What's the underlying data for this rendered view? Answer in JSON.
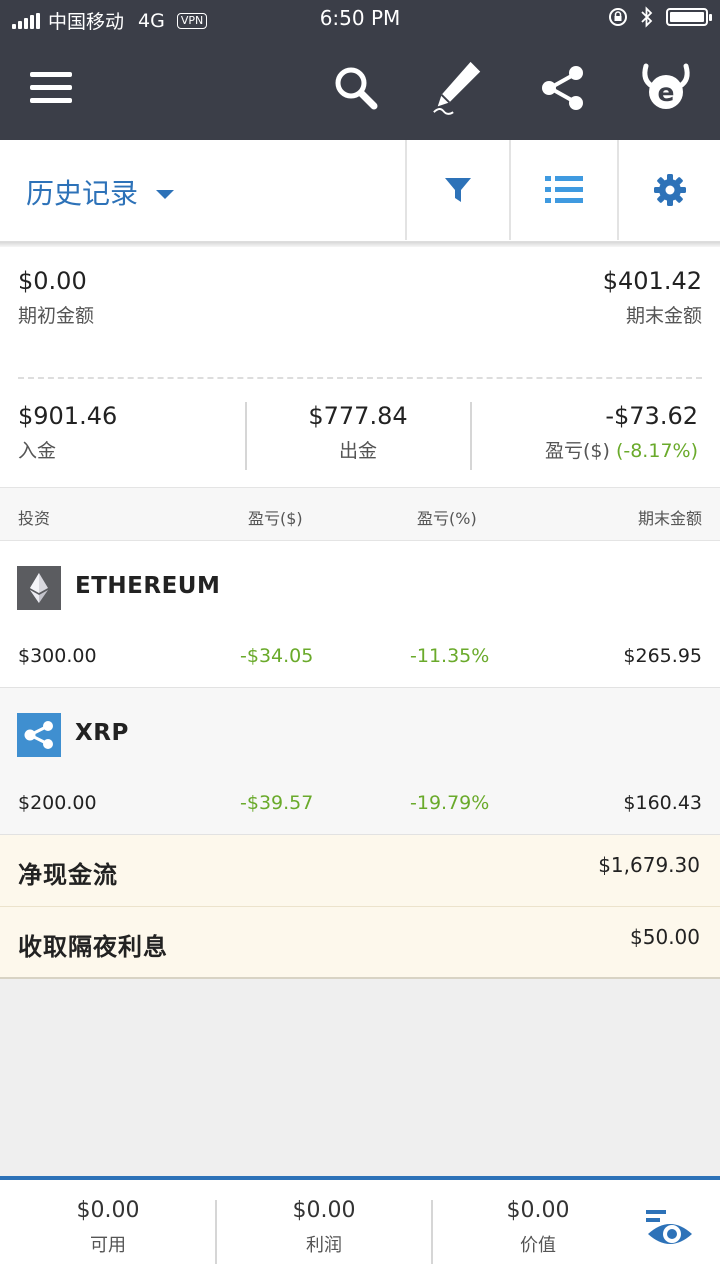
{
  "status_bar": {
    "carrier": "中国移动",
    "network": "4G",
    "vpn": "VPN",
    "time": "6:50 PM"
  },
  "header": {
    "title": "历史记录"
  },
  "summary": {
    "opening": {
      "value": "$0.00",
      "label": "期初金额"
    },
    "closing": {
      "value": "$401.42",
      "label": "期末金额"
    },
    "deposits": {
      "value": "$901.46",
      "label": "入金"
    },
    "withdrawals": {
      "value": "$777.84",
      "label": "出金"
    },
    "profit": {
      "value": "-$73.62",
      "label": "盈亏($)",
      "percent": "(-8.17%)"
    }
  },
  "table": {
    "headers": {
      "invest": "投资",
      "pl_usd": "盈亏($)",
      "pl_pct": "盈亏(%)",
      "end_amount": "期末金额"
    },
    "rows": [
      {
        "name": "ETHEREUM",
        "icon": "ethereum-icon",
        "invested": "$300.00",
        "pl_usd": "-$34.05",
        "pl_pct": "-11.35%",
        "end": "$265.95"
      },
      {
        "name": "XRP",
        "icon": "xrp-icon",
        "invested": "$200.00",
        "pl_usd": "-$39.57",
        "pl_pct": "-19.79%",
        "end": "$160.43"
      }
    ]
  },
  "cash_items": [
    {
      "label": "净现金流",
      "value": "$1,679.30"
    },
    {
      "label": "收取隔夜利息",
      "value": "$50.00"
    }
  ],
  "bottom_bar": [
    {
      "value": "$0.00",
      "label": "可用"
    },
    {
      "value": "$0.00",
      "label": "利润"
    },
    {
      "value": "$0.00",
      "label": "价值"
    }
  ],
  "colors": {
    "accent": "#2d72b8",
    "header_bg": "#3b3e48",
    "positive": "#6aaa2b",
    "cash_bg": "#fdf8ec"
  }
}
